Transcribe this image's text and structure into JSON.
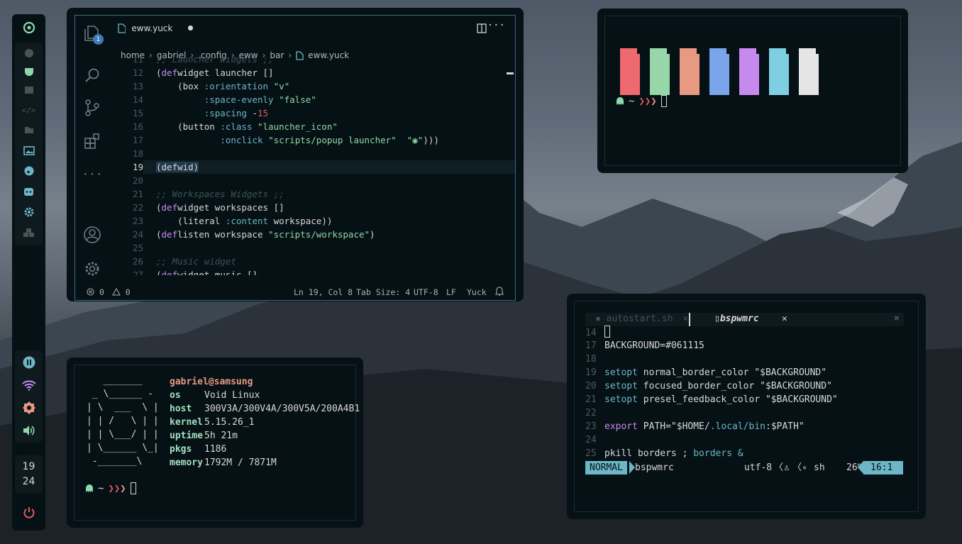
{
  "bar": {
    "clock_hour": "19",
    "clock_minute": "24"
  },
  "vscode": {
    "tab_label": "eww.yuck",
    "breadcrumb": [
      "home",
      "gabriel",
      ".config",
      "eww",
      "bar",
      "eww.yuck"
    ],
    "notification_badge": "1",
    "lines": [
      {
        "n": "11",
        "segs": [
          {
            "t": ";; Launcher Widgets ;;",
            "c": "com"
          }
        ]
      },
      {
        "n": "12",
        "segs": [
          {
            "t": "(",
            "c": ""
          },
          {
            "t": "def",
            "c": "key"
          },
          {
            "t": "widget launcher []",
            "c": ""
          }
        ]
      },
      {
        "n": "13",
        "segs": [
          {
            "t": "    (box ",
            "c": ""
          },
          {
            "t": ":orientation",
            "c": "sym"
          },
          {
            "t": " ",
            "c": ""
          },
          {
            "t": "\"v\"",
            "c": "str"
          }
        ]
      },
      {
        "n": "14",
        "segs": [
          {
            "t": "         ",
            "c": ""
          },
          {
            "t": ":space-evenly",
            "c": "sym"
          },
          {
            "t": " ",
            "c": ""
          },
          {
            "t": "\"false\"",
            "c": "str"
          }
        ]
      },
      {
        "n": "15",
        "segs": [
          {
            "t": "         ",
            "c": ""
          },
          {
            "t": ":spacing",
            "c": "sym"
          },
          {
            "t": " -",
            "c": ""
          },
          {
            "t": "15",
            "c": "num"
          }
        ]
      },
      {
        "n": "16",
        "segs": [
          {
            "t": "    (button ",
            "c": ""
          },
          {
            "t": ":class",
            "c": "sym"
          },
          {
            "t": " ",
            "c": ""
          },
          {
            "t": "\"launcher_icon\"",
            "c": "str"
          }
        ]
      },
      {
        "n": "17",
        "segs": [
          {
            "t": "            ",
            "c": ""
          },
          {
            "t": ":onclick",
            "c": "sym"
          },
          {
            "t": " ",
            "c": ""
          },
          {
            "t": "\"scripts/popup launcher\"",
            "c": "str"
          },
          {
            "t": "  ",
            "c": ""
          },
          {
            "t": "\"◉\"",
            "c": "str"
          },
          {
            "t": ")))",
            "c": ""
          }
        ]
      },
      {
        "n": "18",
        "segs": []
      },
      {
        "n": "19",
        "segs": [
          {
            "t": "(defwid)",
            "c": ""
          }
        ]
      },
      {
        "n": "20",
        "segs": []
      },
      {
        "n": "21",
        "segs": [
          {
            "t": ";; Workspaces Widgets ;;",
            "c": "com"
          }
        ]
      },
      {
        "n": "22",
        "segs": [
          {
            "t": "(",
            "c": ""
          },
          {
            "t": "def",
            "c": "key"
          },
          {
            "t": "widget workspaces []",
            "c": ""
          }
        ]
      },
      {
        "n": "23",
        "segs": [
          {
            "t": "    (literal ",
            "c": ""
          },
          {
            "t": ":content",
            "c": "sym"
          },
          {
            "t": " workspace))",
            "c": ""
          }
        ]
      },
      {
        "n": "24",
        "segs": [
          {
            "t": "(",
            "c": ""
          },
          {
            "t": "def",
            "c": "key"
          },
          {
            "t": "listen workspace ",
            "c": ""
          },
          {
            "t": "\"scripts/workspace\"",
            "c": "str"
          },
          {
            "t": ")",
            "c": ""
          }
        ]
      },
      {
        "n": "25",
        "segs": []
      },
      {
        "n": "26",
        "segs": [
          {
            "t": ";; Music widget",
            "c": "com"
          }
        ]
      },
      {
        "n": "27",
        "segs": [
          {
            "t": "(",
            "c": ""
          },
          {
            "t": "def",
            "c": "key"
          },
          {
            "t": "widget music []",
            "c": ""
          }
        ]
      }
    ],
    "status": {
      "errors": "0",
      "warnings": "0",
      "position": "Ln 19, Col 8",
      "tab_size": "Tab Size: 4",
      "encoding": "UTF-8",
      "eol": "LF",
      "language": "Yuck"
    }
  },
  "colors_term": {
    "swatches": [
      "#ee6a70",
      "#96d6a9",
      "#e89982",
      "#7ba5ea",
      "#c68aee",
      "#7fcfe3",
      "#e5e5e5"
    ],
    "prompt": "~"
  },
  "nvim": {
    "tabs": {
      "inactive": "autostart.sh",
      "active": "bspwmrc"
    },
    "lines": [
      {
        "n": "14",
        "segs": []
      },
      {
        "n": "17",
        "segs": [
          {
            "t": "BACKGROUND=#061115",
            "c": ""
          }
        ]
      },
      {
        "n": "18",
        "segs": []
      },
      {
        "n": "19",
        "segs": [
          {
            "t": "setopt",
            "c": "sym"
          },
          {
            "t": " normal_border_color \"$BACKGROUND\"",
            "c": ""
          }
        ]
      },
      {
        "n": "20",
        "segs": [
          {
            "t": "setopt",
            "c": "sym"
          },
          {
            "t": " focused_border_color \"$BACKGROUND\"",
            "c": ""
          }
        ]
      },
      {
        "n": "21",
        "segs": [
          {
            "t": "setopt",
            "c": "sym"
          },
          {
            "t": " presel_feedback_color \"$BACKGROUND\"",
            "c": ""
          }
        ]
      },
      {
        "n": "22",
        "segs": []
      },
      {
        "n": "23",
        "segs": [
          {
            "t": "export",
            "c": "key"
          },
          {
            "t": " PATH=\"$HOME/",
            "c": ""
          },
          {
            "t": ".local/bin",
            "c": "sym"
          },
          {
            "t": ":$PATH\"",
            "c": ""
          }
        ]
      },
      {
        "n": "24",
        "segs": []
      },
      {
        "n": "25",
        "segs": [
          {
            "t": "pkill borders ; ",
            "c": ""
          },
          {
            "t": "borders &",
            "c": "sym"
          }
        ]
      }
    ],
    "status": {
      "mode": "NORMAL",
      "file": "bspwmrc",
      "encoding": "utf-8",
      "filetype": "sh",
      "percent": "26%",
      "position": "16:1"
    }
  },
  "fetch": {
    "ascii": "   _______\n _ \\______ -\n| \\  ___  \\ |\n| | /   \\ | |\n| | \\___/ | |\n| \\______ \\_|\n -_______\\",
    "user": "gabriel@samsung",
    "rows": [
      {
        "k": "os",
        "v": "Void Linux"
      },
      {
        "k": "host",
        "v": "300V3A/300V4A/300V5A/200A4B1"
      },
      {
        "k": "kernel",
        "v": "5.15.26_1"
      },
      {
        "k": "uptime",
        "v": "5h 21m"
      },
      {
        "k": "pkgs",
        "v": "1186"
      },
      {
        "k": "memory",
        "v": "1792M / 7871M"
      }
    ],
    "prompt": "~"
  },
  "colors": {
    "bg": "#061115",
    "accent": "#6cb6c8",
    "green": "#8fd8a8",
    "red": "#df5b61",
    "orange": "#e89982",
    "purple": "#c68aee"
  }
}
